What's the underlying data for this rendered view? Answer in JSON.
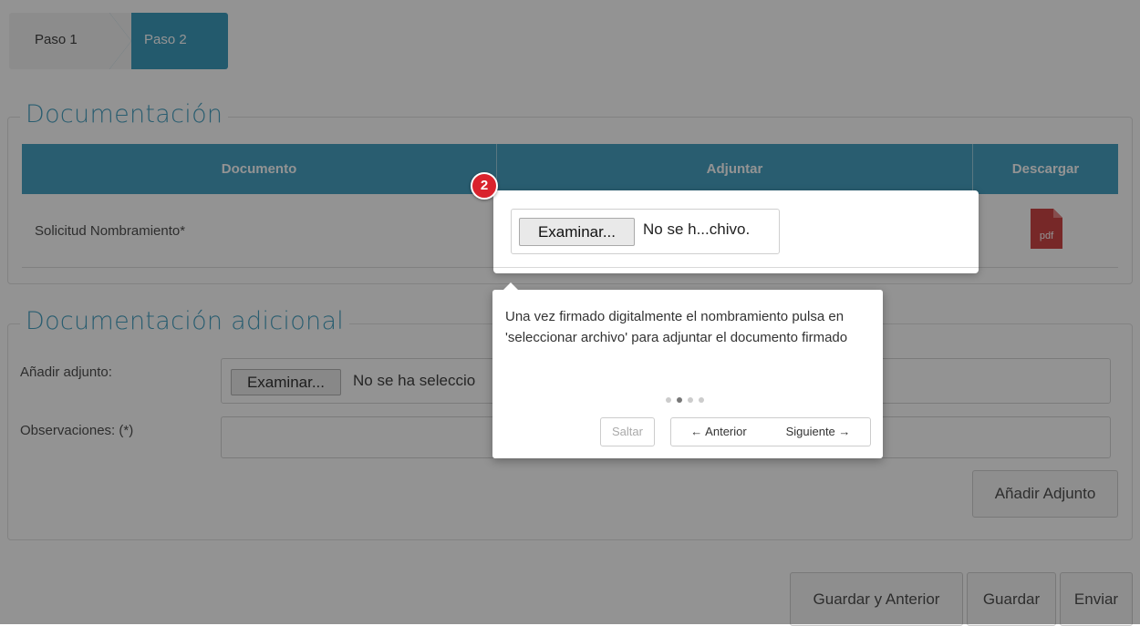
{
  "steps": [
    {
      "label": "Paso 1"
    },
    {
      "label": "Paso 2"
    }
  ],
  "documentacion": {
    "legend": "Documentación",
    "table": {
      "headers": [
        "Documento",
        "Adjuntar",
        "Descargar"
      ],
      "rows": [
        {
          "documento": "Solicitud Nombramiento*",
          "descargar_icon": "pdf-icon",
          "pdf_label": "pdf"
        }
      ]
    }
  },
  "adicional": {
    "legend": "Documentación adicional",
    "adjunto_label": "Añadir adjunto:",
    "observaciones_label": "Observaciones: (*)",
    "file_button": "Examinar...",
    "file_status": "No se ha seleccio",
    "add_button": "Añadir Adjunto"
  },
  "footer": {
    "guardar_anterior": "Guardar y Anterior",
    "guardar": "Guardar",
    "enviar": "Enviar"
  },
  "tour": {
    "step_number": "2",
    "highlight_file_button": "Examinar...",
    "highlight_file_status": "No se h...chivo.",
    "text": "Una vez firmado digitalmente el nombramiento pulsa en 'seleccionar archivo' para adjuntar el documento firmado",
    "skip": "Saltar",
    "prev": "← Anterior",
    "next": "Siguiente →",
    "total_steps": 4,
    "active_step_dot": 2
  },
  "colors": {
    "accent": "#2b93b8",
    "badge": "#d9232d",
    "pdf": "#c62828"
  }
}
